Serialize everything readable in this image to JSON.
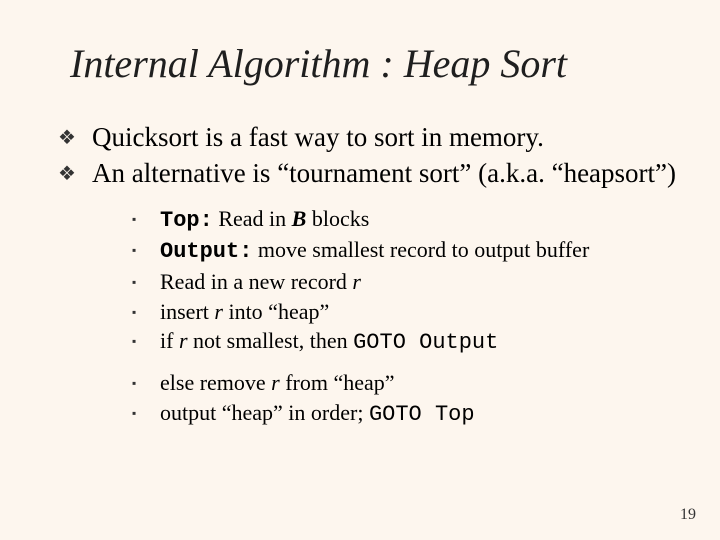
{
  "title": "Internal Algorithm : Heap Sort",
  "bullets": [
    {
      "text": "Quicksort is a fast way to sort in memory."
    },
    {
      "text": "An alternative is “tournament sort” (a.k.a. “heapsort”)"
    }
  ],
  "sub": {
    "s1_label": "Top:",
    "s1_rest1": " Read in ",
    "s1_B": "B",
    "s1_rest2": " blocks",
    "s2_label": "Output:",
    "s2_rest": " move smallest record to output buffer",
    "s3_pre": "Read in a new record ",
    "s3_r": "r",
    "s4_pre": "insert ",
    "s4_r": "r",
    "s4_post": " into “heap”",
    "s5_pre": "if ",
    "s5_r": "r",
    "s5_mid": " not smallest, then ",
    "s5_goto": "GOTO Output",
    "s6_pre": "else remove ",
    "s6_r": "r",
    "s6_post": " from “heap”",
    "s7_pre": "output “heap” in order; ",
    "s7_goto": "GOTO Top"
  },
  "pagenum": "19",
  "glyphs": {
    "diamond": "❖",
    "square": "▪"
  }
}
